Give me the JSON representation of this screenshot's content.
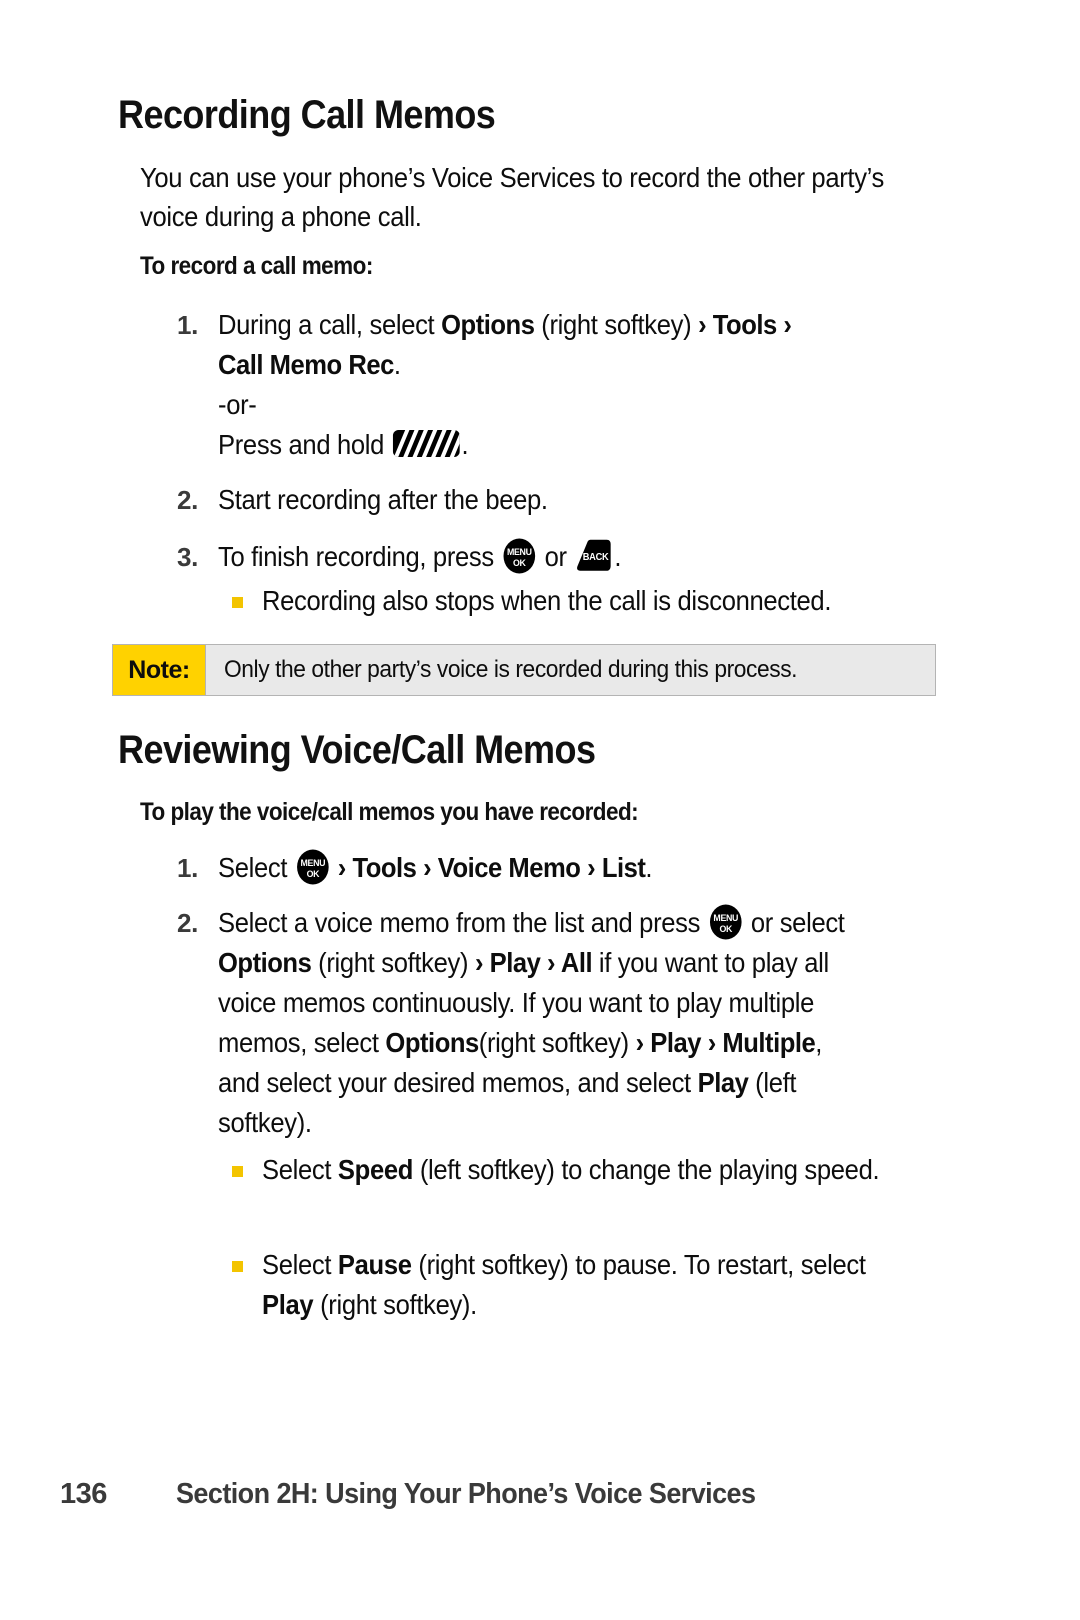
{
  "document": {
    "type": "phone-user-guide-page",
    "colors": {
      "note_label_bg": "#FFD200",
      "note_body_bg": "#E9E9E9",
      "bullet_marker": "#F3C400",
      "text": "#0d0d0d",
      "muted_text": "#3a3a3a"
    }
  },
  "sections": [
    {
      "heading": "Recording Call Memos",
      "intro": "You can use your phone’s Voice Services to record the other party’s voice during a phone call.",
      "subhead": "To record a call memo:"
    },
    {
      "heading": "Reviewing Voice/Call Memos",
      "subhead": "To play the voice/call memos you have recorded:"
    }
  ],
  "steps_record": [
    {
      "number": "1.",
      "line1_pre": "During a call, select ",
      "line1_b1": "Options",
      "line1_mid": " (right softkey) ",
      "line1_chev1": "›",
      "line1_b2": " Tools ",
      "line1_chev2": "›",
      "line2_b": "Call Memo Rec",
      "line2_post": ".",
      "or_text": "-or-",
      "line3_pre": "Press and hold ",
      "line3_icon": "side-key-icon",
      "line3_post": "."
    },
    {
      "number": "2.",
      "text": "Start recording after the beep."
    },
    {
      "number": "3.",
      "pre": "To finish recording, press ",
      "icon1": "menu-ok-key-icon",
      "mid": " or ",
      "icon2": "back-key-icon",
      "post": "."
    }
  ],
  "bullets_record": [
    {
      "text": "Recording also stops when the call is disconnected."
    }
  ],
  "note": {
    "label": "Note:",
    "text": "Only the other party’s voice is recorded during this process."
  },
  "steps_review": [
    {
      "number": "1.",
      "pre": "Select ",
      "icon": "menu-ok-key-icon",
      "chev1": " › ",
      "b1": "Tools",
      "chev2": " › ",
      "b2": "Voice Memo",
      "chev3": " › ",
      "b3": "List",
      "post": "."
    },
    {
      "number": "2.",
      "l1_pre": "Select a voice memo from the list and press ",
      "l1_icon": "menu-ok-key-icon",
      "l1_post": " or select",
      "l2_b1": "Options",
      "l2_t1": " (right softkey) ",
      "l2_c1": "›",
      "l2_b2": " Play ",
      "l2_c2": "›",
      "l2_b3": " All",
      "l2_t2": " if you want to play all",
      "l3": "voice memos continuously. If you want to play multiple",
      "l4_pre": "memos, select ",
      "l4_b1": "Options",
      "l4_t1": "(right softkey) ",
      "l4_c1": "›",
      "l4_b2": " Play ",
      "l4_c2": "›",
      "l4_b3": " Multiple",
      "l4_t2": ",",
      "l5_pre": "and select your desired memos, and select ",
      "l5_b": "Play",
      "l5_post": " (left",
      "l6": "softkey)."
    }
  ],
  "bullets_review": [
    {
      "pre": "Select ",
      "b": "Speed",
      "post": " (left softkey) to change the playing speed."
    },
    {
      "pre": "Select ",
      "b": "Pause",
      "mid": " (right softkey) to pause. To restart, select ",
      "b2": "Play",
      "post": " (right softkey)."
    }
  ],
  "footer": {
    "page_number": "136",
    "section_title": "Section 2H: Using Your Phone’s Voice Services"
  },
  "icons": {
    "menu_ok": {
      "name": "menu-ok-key-icon",
      "top_label": "MENU",
      "bottom_label": "OK"
    },
    "back": {
      "name": "back-key-icon",
      "label": "BACK"
    },
    "side_key": {
      "name": "side-key-icon",
      "label": ""
    }
  }
}
